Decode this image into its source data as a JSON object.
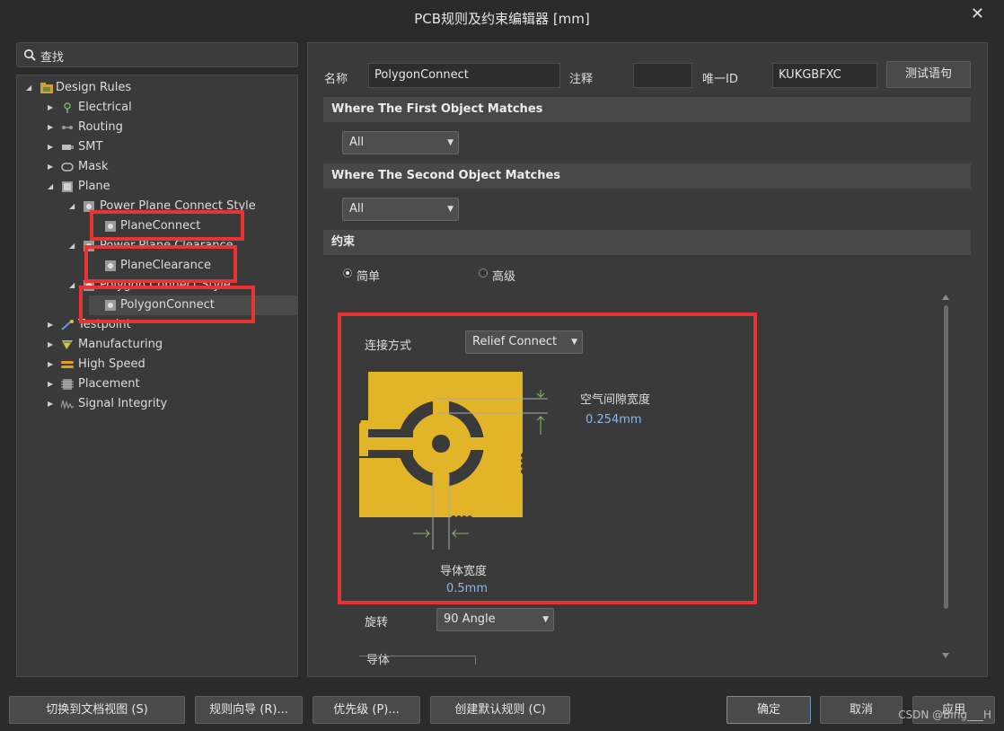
{
  "window": {
    "title": "PCB规则及约束编辑器 [mm]",
    "close_glyph": "✕"
  },
  "search": {
    "value": "查找"
  },
  "tree": {
    "root": "Design Rules",
    "categories": [
      "Electrical",
      "Routing",
      "SMT",
      "Mask",
      "Plane"
    ],
    "plane_children": [
      "Power Plane Connect Style",
      "Power Plane Clearance",
      "Polygon Connect Style"
    ],
    "leaves": [
      "PlaneConnect",
      "PlaneClearance",
      "PolygonConnect"
    ],
    "categories_after": [
      "Testpoint",
      "Manufacturing",
      "High Speed",
      "Placement",
      "Signal Integrity"
    ]
  },
  "rule": {
    "name_label": "名称",
    "name_value": "PolygonConnect",
    "comment_label": "注释",
    "comment_value": "",
    "uid_label": "唯一ID",
    "uid_value": "KUKGBFXC",
    "test_button": "测试语句"
  },
  "first_match": {
    "header": "Where The First Object Matches",
    "selected": "All"
  },
  "second_match": {
    "header": "Where The Second Object Matches",
    "selected": "All"
  },
  "constraints": {
    "header": "约束",
    "mode_simple": "简单",
    "mode_advanced": "高级",
    "connect_label": "连接方式",
    "connect_value": "Relief Connect",
    "air_gap_label": "空气间隙宽度",
    "air_gap_value": "0.254mm",
    "conductor_width_label": "导体宽度",
    "conductor_width_value": "0.5mm",
    "rotation_label": "旋转",
    "rotation_value": "90 Angle",
    "conductor_label": "导体"
  },
  "buttons": {
    "doc_view": "切换到文档视图 (S)",
    "wizard": "规则向导 (R)...",
    "priority": "优先级 (P)...",
    "create_default": "创建默认规则 (C)",
    "ok": "确定",
    "cancel": "取消",
    "apply": "应用"
  },
  "watermark": "CSDN @Bing___H",
  "colors": {
    "accent_red": "#e83434",
    "copper": "#e2b428",
    "value_blue": "#8fb6e8"
  }
}
